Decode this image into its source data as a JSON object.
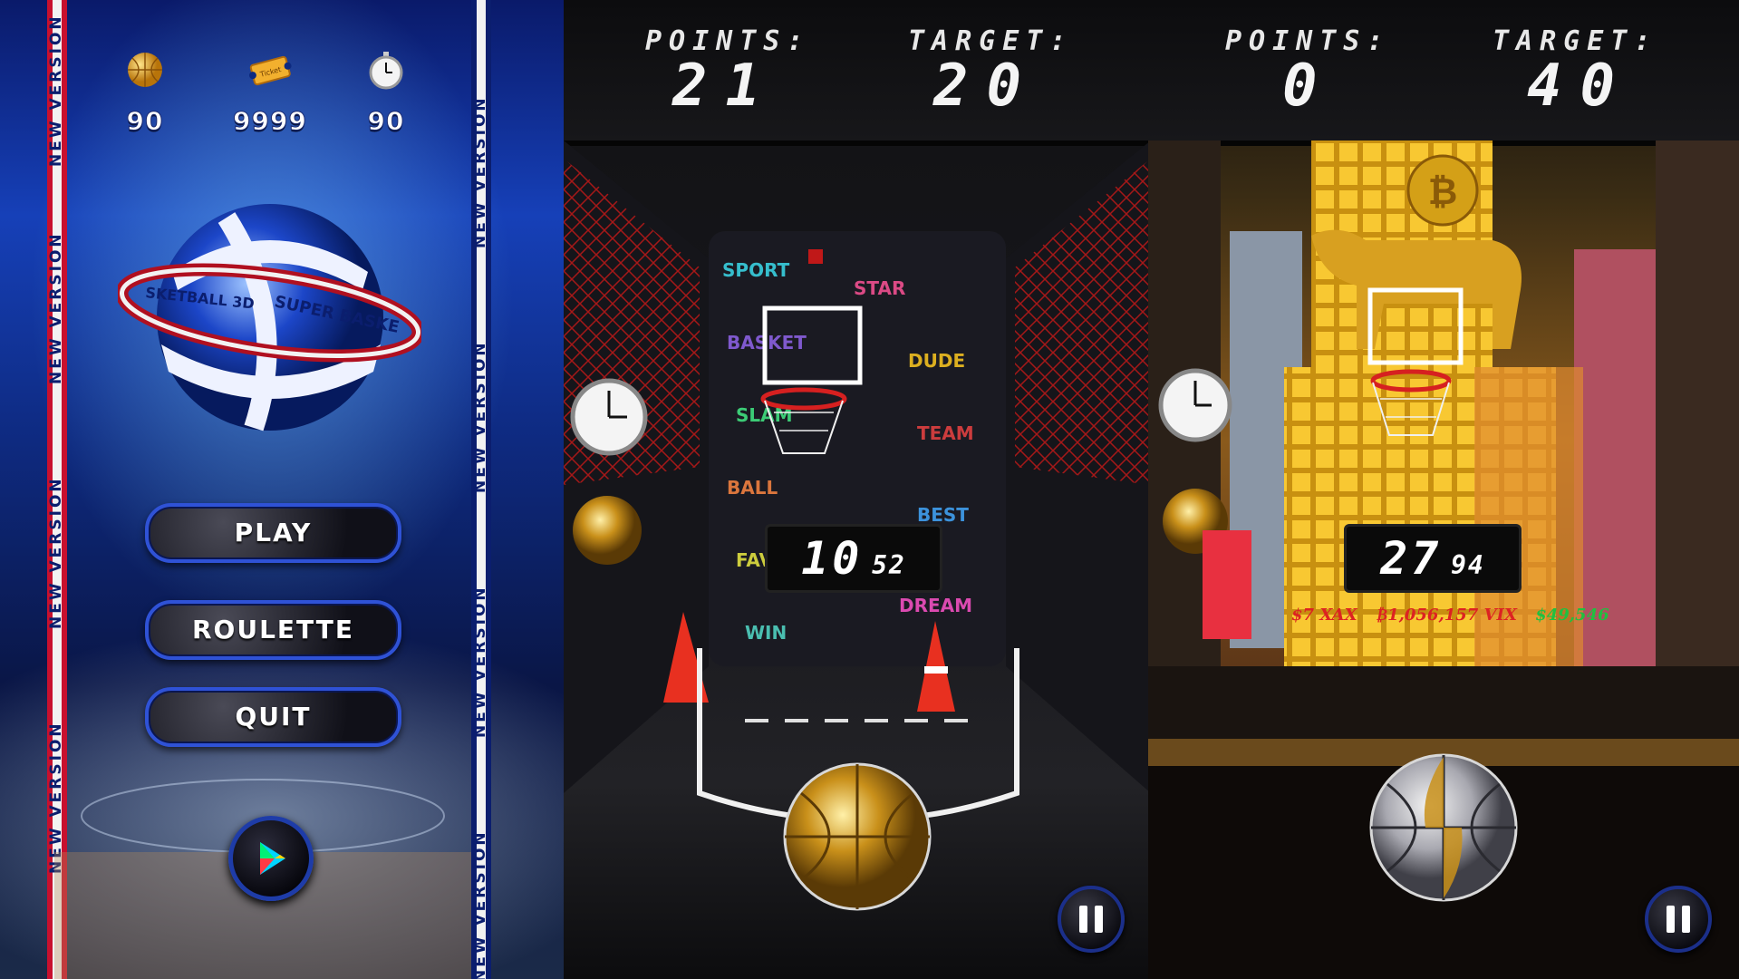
{
  "menu": {
    "stats": [
      {
        "icon": "gold-ball-icon",
        "value": "90"
      },
      {
        "icon": "ticket-icon",
        "value": "9999",
        "ticket_text": "Ticket"
      },
      {
        "icon": "stopwatch-icon",
        "value": "90"
      }
    ],
    "logo_text_left": "SKETBALL 3D",
    "logo_text_right": "SUPER BASKE",
    "buttons": {
      "play": "PLAY",
      "roulette": "ROULETTE",
      "quit": "QUIT"
    },
    "stripe_text": "NEW VERSION",
    "play_store_icon": "google-play-icon"
  },
  "game1": {
    "points_label": "POINTS:",
    "points_value": "21",
    "target_label": "TARGET:",
    "target_value": "20",
    "timer_seconds": "10",
    "timer_hundredths": "52",
    "theme": "graffiti"
  },
  "game2": {
    "points_label": "POINTS:",
    "points_value": "0",
    "target_label": "TARGET:",
    "target_value": "40",
    "timer_seconds": "27",
    "timer_hundredths": "94",
    "ticker": [
      "$7 XAX",
      "₿1,056,157 VIX",
      "$49,546"
    ],
    "theme": "wall-street"
  },
  "colors": {
    "menu_blue": "#1640b8",
    "stripe_red": "#c8102e",
    "stripe_blue": "#0b1e6e",
    "gold": "#d4a017"
  }
}
